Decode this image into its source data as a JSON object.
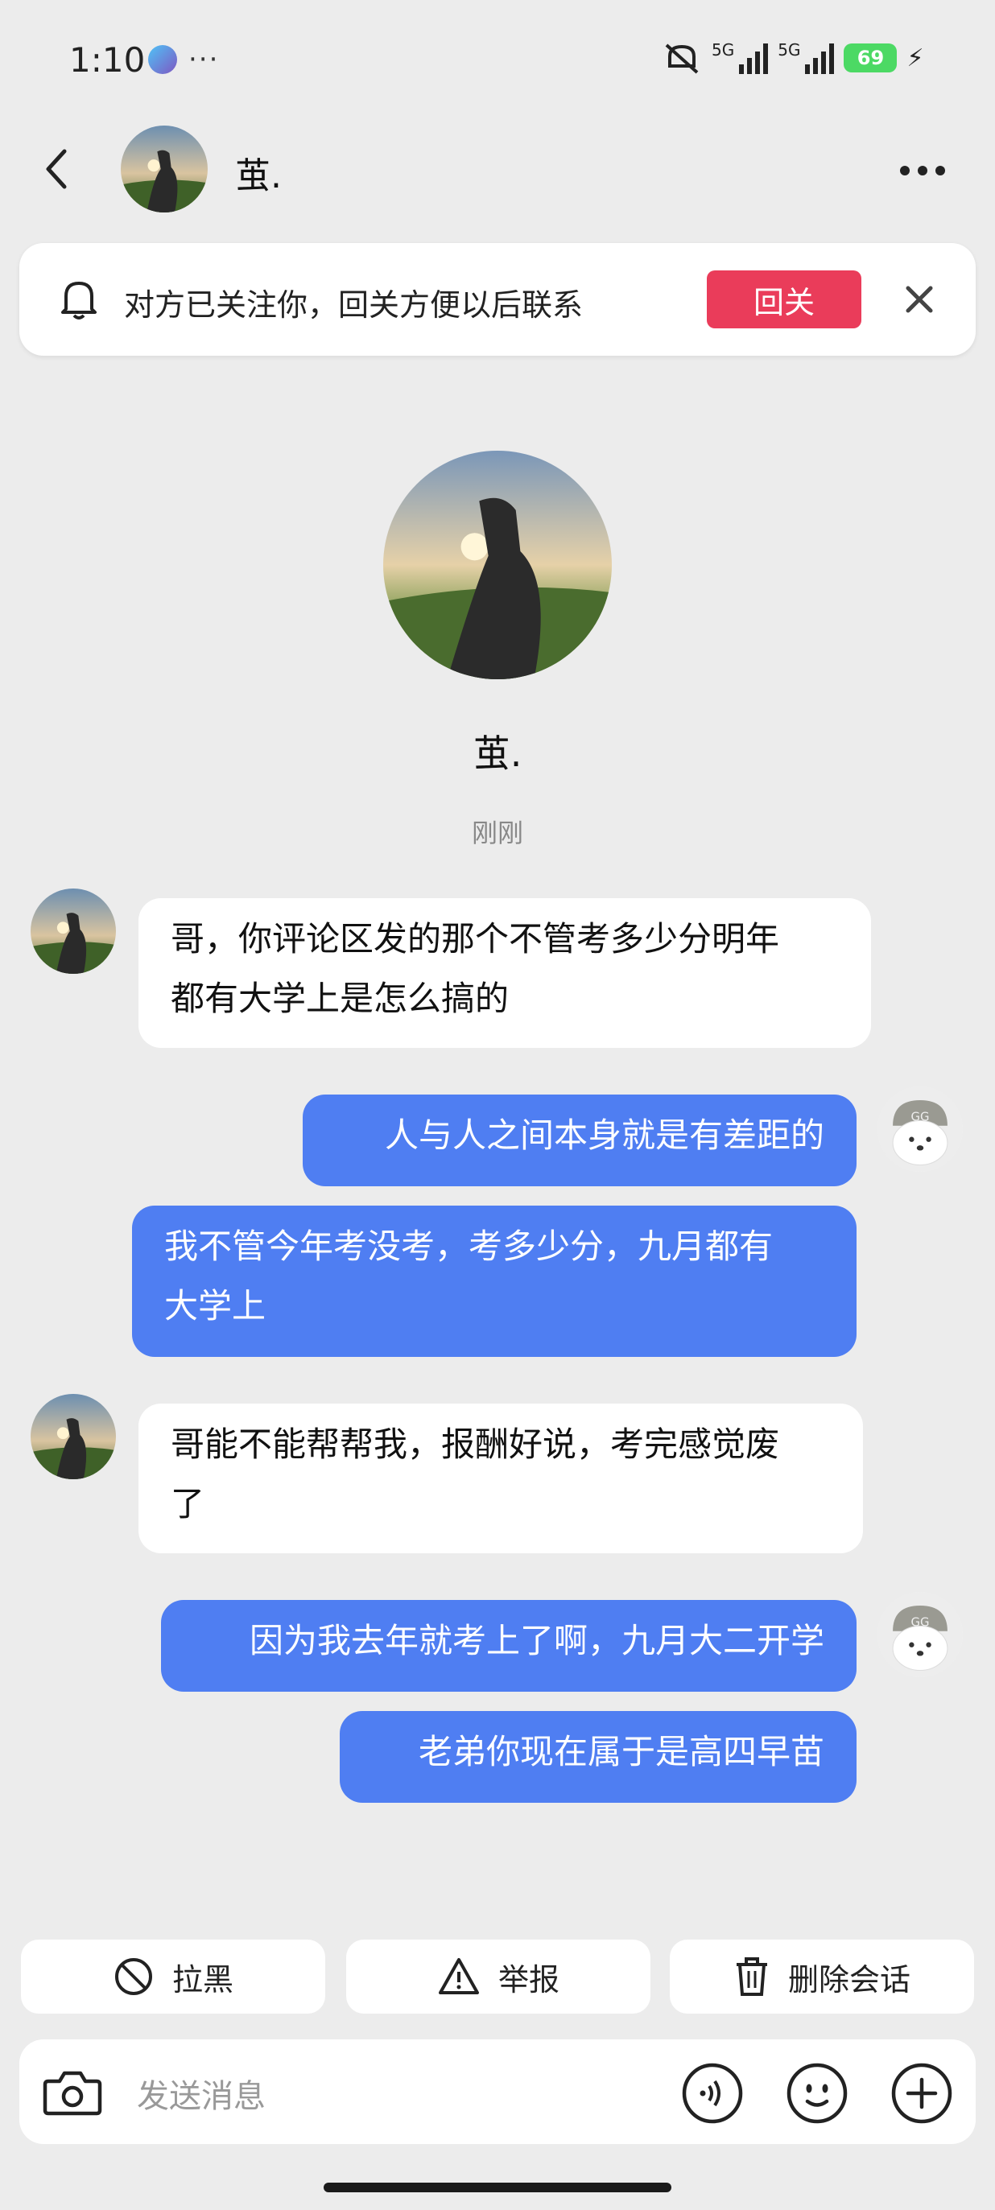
{
  "status_bar": {
    "time": "1:10",
    "dots": "···",
    "network_label_1": "5G",
    "network_label_2": "5G",
    "battery": "69"
  },
  "header": {
    "contact_name": "茧."
  },
  "banner": {
    "text": "对方已关注你，回关方便以后联系",
    "follow_label": "回关"
  },
  "profile": {
    "name": "茧.",
    "timestamp": "刚刚"
  },
  "messages": [
    {
      "direction": "in",
      "line1": "哥，你评论区发的那个不管考多少分明年",
      "line2": "都有大学上是怎么搞的"
    },
    {
      "direction": "out",
      "line1": "人与人之间本身就是有差距的"
    },
    {
      "direction": "out",
      "line1": "我不管今年考没考，考多少分，九月都有",
      "line2": "大学上"
    },
    {
      "direction": "in",
      "line1": "哥能不能帮帮我，报酬好说，考完感觉废",
      "line2": "了"
    },
    {
      "direction": "out",
      "line1": "因为我去年就考上了啊，九月大二开学"
    },
    {
      "direction": "out",
      "line1": "老弟你现在属于是高四早苗"
    }
  ],
  "actions": {
    "block": "拉黑",
    "report": "举报",
    "delete": "删除会话"
  },
  "input": {
    "placeholder": "发送消息"
  },
  "colors": {
    "outgoing_bubble": "#4f7ef2",
    "follow_button": "#ea3c5a",
    "background": "#ececec"
  }
}
